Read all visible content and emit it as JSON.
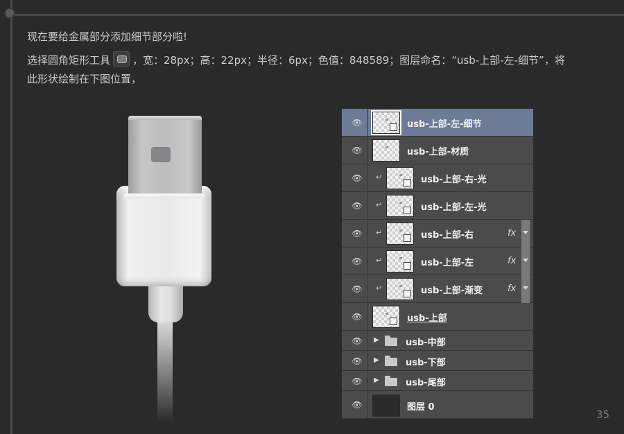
{
  "instructions": {
    "line1": "现在要给金属部分添加细节部分啦!",
    "line2_before_icon": "选择圆角矩形工具",
    "line2_after_icon": "，宽：28px；高：22px；半径：6px；色值：848589；图层命名：“usb-上部-左-细节”，将",
    "line3": "此形状绘制在下图位置，"
  },
  "tool_icon": "rounded-rectangle-tool-icon",
  "colors": {
    "detail_fill": "#848589",
    "selected_layer": "#6c7c97"
  },
  "layers_panel": {
    "layers": [
      {
        "name": "usb-上部-左-细节",
        "selected": true,
        "clipped": false,
        "fx": false,
        "linked": true
      },
      {
        "name": "usb-上部-材质",
        "selected": false,
        "clipped": false,
        "fx": false,
        "linked": false
      },
      {
        "name": "usb-上部-右-光",
        "selected": false,
        "clipped": true,
        "fx": false,
        "linked": true
      },
      {
        "name": "usb-上部-左-光",
        "selected": false,
        "clipped": true,
        "fx": false,
        "linked": true
      },
      {
        "name": "usb-上部-右",
        "selected": false,
        "clipped": true,
        "fx": true,
        "fx_label": "fx",
        "linked": true
      },
      {
        "name": "usb-上部-左",
        "selected": false,
        "clipped": true,
        "fx": true,
        "fx_label": "fx",
        "linked": true
      },
      {
        "name": "usb-上部-渐变",
        "selected": false,
        "clipped": true,
        "fx": true,
        "fx_label": "fx",
        "linked": true
      },
      {
        "name": "usb-上部",
        "selected": false,
        "clipped": false,
        "fx": false,
        "linked": true
      }
    ],
    "groups": [
      {
        "name": "usb-中部"
      },
      {
        "name": "usb-下部"
      },
      {
        "name": "usb-尾部"
      }
    ],
    "background_layer": {
      "name": "图层 0"
    }
  },
  "page_number": "35"
}
